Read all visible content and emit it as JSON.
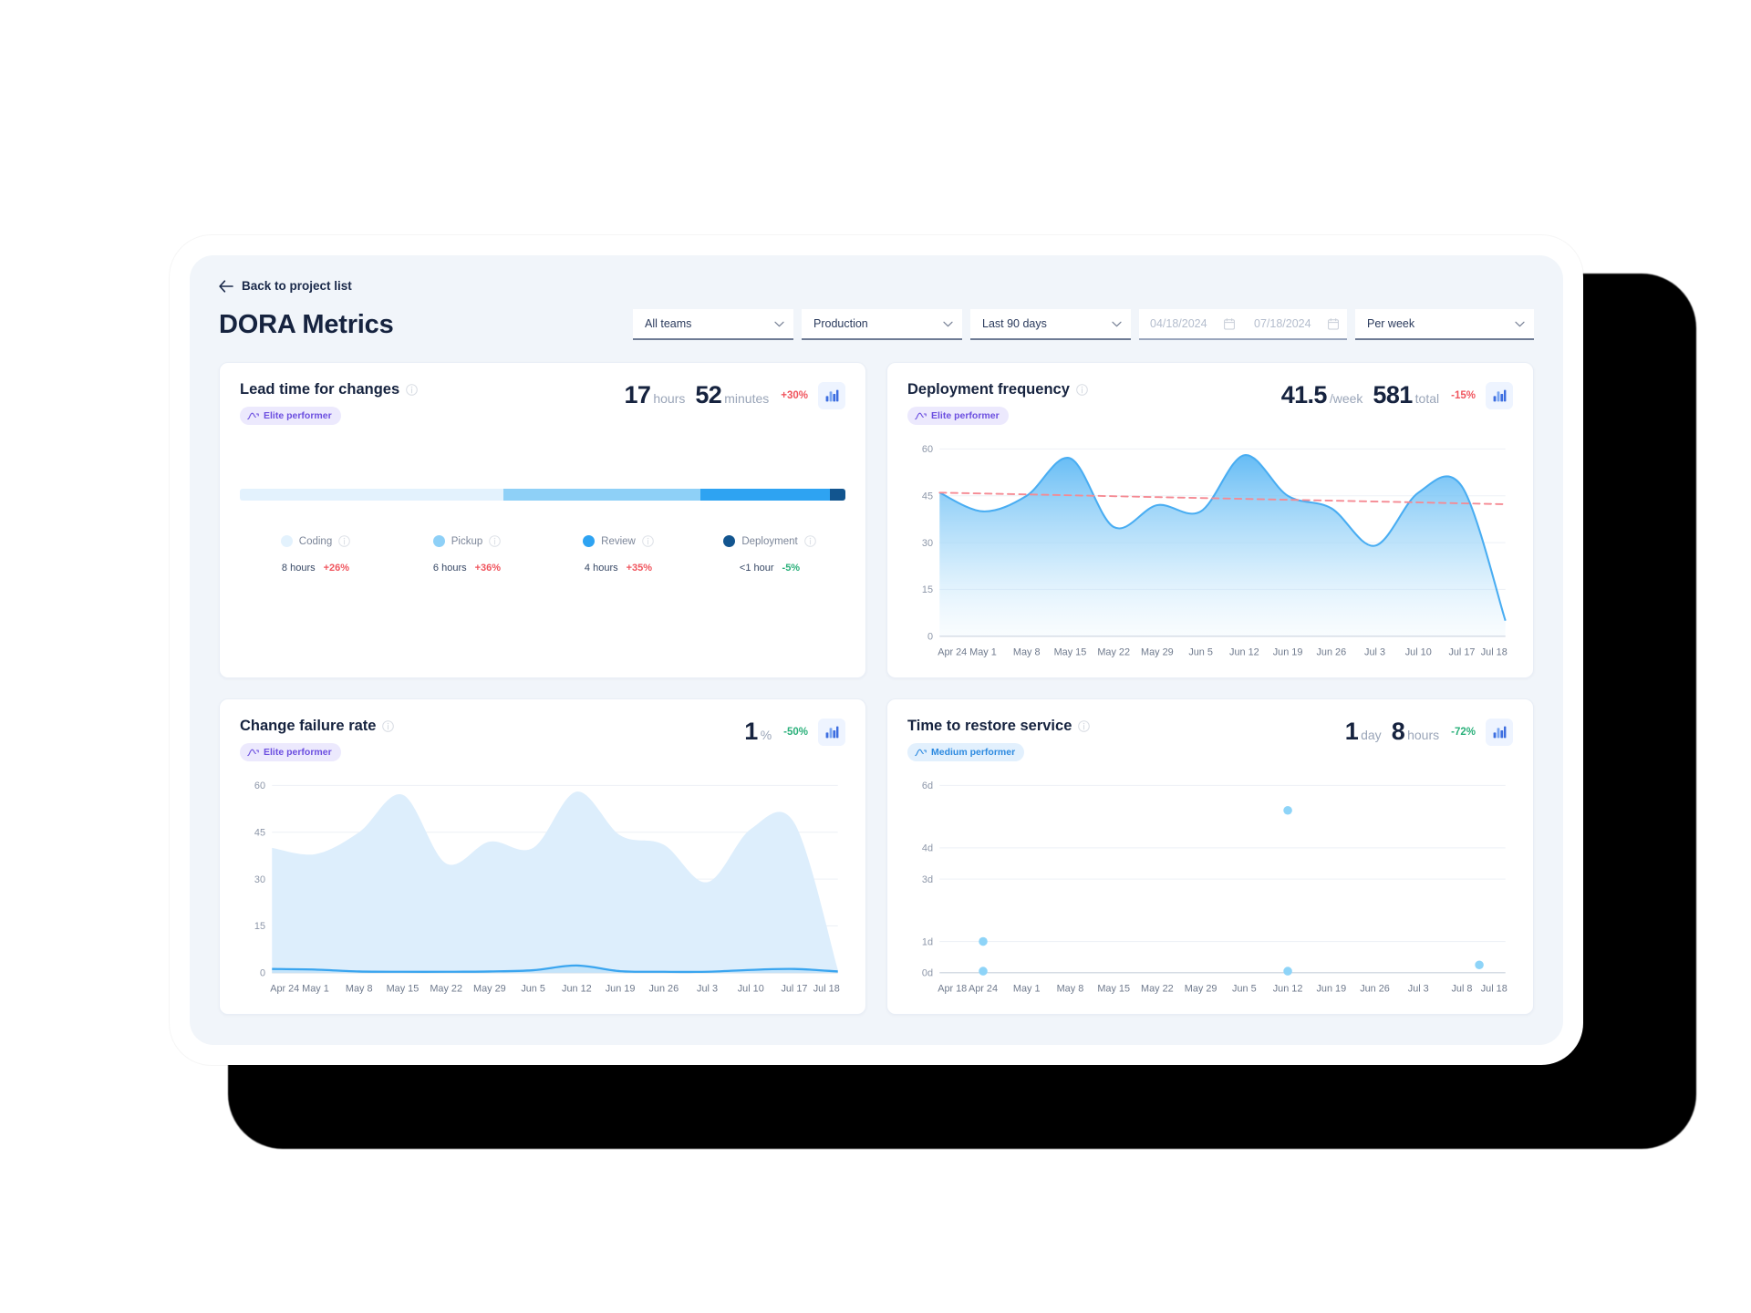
{
  "nav": {
    "back_label": "Back to project list",
    "back_icon": "arrow-left-icon"
  },
  "header": {
    "title": "DORA Metrics"
  },
  "filters": [
    {
      "name": "team",
      "value": "All teams",
      "icon": "chevron-down-icon"
    },
    {
      "name": "environment",
      "value": "Production",
      "icon": "chevron-down-icon"
    },
    {
      "name": "period",
      "value": "Last 90 days",
      "icon": "chevron-down-icon"
    },
    {
      "name": "granularity",
      "value": "Per week",
      "icon": "chevron-down-icon"
    }
  ],
  "date_range": {
    "start_placeholder": "04/18/2024",
    "end_placeholder": "07/18/2024",
    "icon": "calendar-icon"
  },
  "colors": {
    "accent": "#3aa5ef",
    "elite_badge_bg": "#ece9fd",
    "elite_badge_text": "#6c4fe0",
    "medium_badge_bg": "#e2f0fd",
    "medium_badge_text": "#2d8ae0",
    "trend_up": "#f0555e",
    "trend_down": "#2ab07a",
    "title": "#16233f",
    "page_bg": "#f1f5fa",
    "coding": "#e3f2fd",
    "pickup": "#8ed0f7",
    "review": "#2ea3f2",
    "deployment": "#12558f",
    "trendline": "#f58a93"
  },
  "cards": {
    "lead_time": {
      "title": "Lead time for changes",
      "info_icon": "info-icon",
      "badge": {
        "label": "Elite performer",
        "icon": "trend-spark-icon",
        "kind": "elite"
      },
      "stats": [
        {
          "value": "17",
          "unit": "hours"
        },
        {
          "value": "52",
          "unit": "minutes"
        }
      ],
      "trend": {
        "value": "+30%",
        "direction": "up"
      },
      "chart_button_icon": "bar-chart-icon",
      "segments": [
        {
          "label": "Coding",
          "value": "8 hours",
          "delta": "+26%",
          "delta_dir": "up",
          "pct": 43.5,
          "color": "#e3f2fd"
        },
        {
          "label": "Pickup",
          "value": "6 hours",
          "delta": "+36%",
          "delta_dir": "up",
          "pct": 32.5,
          "color": "#8ed0f7"
        },
        {
          "label": "Review",
          "value": "4 hours",
          "delta": "+35%",
          "delta_dir": "up",
          "pct": 21.5,
          "color": "#2ea3f2"
        },
        {
          "label": "Deployment",
          "value": "<1 hour",
          "delta": "-5%",
          "delta_dir": "down",
          "pct": 2.5,
          "color": "#12558f"
        }
      ]
    },
    "deployment_frequency": {
      "title": "Deployment frequency",
      "info_icon": "info-icon",
      "badge": {
        "label": "Elite performer",
        "icon": "trend-spark-icon",
        "kind": "elite"
      },
      "stats": [
        {
          "value": "41.5",
          "unit": "/week"
        },
        {
          "value": "581",
          "unit": "total"
        }
      ],
      "trend": {
        "value": "-15%",
        "direction": "up"
      },
      "chart_button_icon": "bar-chart-icon"
    },
    "change_failure_rate": {
      "title": "Change failure rate",
      "info_icon": "info-icon",
      "badge": {
        "label": "Elite performer",
        "icon": "trend-spark-icon",
        "kind": "elite"
      },
      "stats": [
        {
          "value": "1",
          "unit": "%"
        }
      ],
      "trend": {
        "value": "-50%",
        "direction": "down"
      },
      "chart_button_icon": "bar-chart-icon"
    },
    "time_to_restore": {
      "title": "Time to restore service",
      "info_icon": "info-icon",
      "badge": {
        "label": "Medium performer",
        "icon": "trend-spark-icon",
        "kind": "medium"
      },
      "stats": [
        {
          "value": "1",
          "unit": "day"
        },
        {
          "value": "8",
          "unit": "hours"
        }
      ],
      "trend": {
        "value": "-72%",
        "direction": "down"
      },
      "chart_button_icon": "bar-chart-icon"
    }
  },
  "chart_data": [
    {
      "id": "deployment-frequency-chart",
      "type": "area",
      "title": "Deployment frequency",
      "xlabel": "",
      "ylabel": "",
      "ylim": [
        0,
        60
      ],
      "yticks": [
        0,
        15,
        30,
        45,
        60
      ],
      "grid": true,
      "legend": "none",
      "x": [
        "Apr 24",
        "May 1",
        "May 8",
        "May 15",
        "May 22",
        "May 29",
        "Jun 5",
        "Jun 12",
        "Jun 19",
        "Jun 26",
        "Jul 3",
        "Jul 10",
        "Jul 17",
        "Jul 18"
      ],
      "series": [
        {
          "name": "Deployments per week",
          "values": [
            46,
            40,
            45,
            57,
            35,
            42,
            40,
            58,
            45,
            41,
            29,
            46,
            48,
            5
          ]
        },
        {
          "name": "Trend (average)",
          "style": "dashed",
          "color": "#f58a93",
          "values": [
            46,
            45.7,
            45.4,
            45.1,
            44.8,
            44.5,
            44.3,
            44.0,
            43.7,
            43.4,
            43.1,
            42.8,
            42.5,
            42.3
          ]
        }
      ]
    },
    {
      "id": "change-failure-rate-chart",
      "type": "area",
      "title": "Change failure rate",
      "xlabel": "",
      "ylabel": "",
      "ylim": [
        0,
        60
      ],
      "yticks": [
        0,
        15,
        30,
        45,
        60
      ],
      "grid": true,
      "legend": "none",
      "x": [
        "Apr 24",
        "May 1",
        "May 8",
        "May 15",
        "May 22",
        "May 29",
        "Jun 5",
        "Jun 12",
        "Jun 19",
        "Jun 26",
        "Jul 3",
        "Jul 10",
        "Jul 17",
        "Jul 18"
      ],
      "series": [
        {
          "name": "Deployments (background)",
          "color": "#ddeefc",
          "values": [
            40,
            38,
            45,
            57,
            35,
            42,
            40,
            58,
            44,
            41,
            29,
            46,
            48,
            1
          ]
        },
        {
          "name": "Failures",
          "color": "#3aa5ef",
          "values": [
            1.2,
            1.0,
            0.4,
            0.3,
            0.3,
            0.4,
            0.8,
            2.3,
            0.5,
            0.3,
            0.3,
            0.9,
            1.2,
            0.4
          ]
        }
      ]
    },
    {
      "id": "time-to-restore-chart",
      "type": "scatter",
      "title": "Time to restore service",
      "xlabel": "",
      "ylabel": "",
      "ylim": [
        0,
        6
      ],
      "yticks": [
        "0d",
        "1d",
        "3d",
        "4d",
        "6d"
      ],
      "ytick_values": [
        0,
        1,
        3,
        4,
        6
      ],
      "grid": true,
      "legend": "none",
      "x_ticks": [
        "Apr 18",
        "Apr 24",
        "May 1",
        "May 8",
        "May 15",
        "May 22",
        "May 29",
        "Jun 5",
        "Jun 12",
        "Jun 19",
        "Jun 26",
        "Jul 3",
        "Jul 8",
        "Jul 18"
      ],
      "points": [
        {
          "x": "Apr 24",
          "y": 1.0
        },
        {
          "x": "Apr 24",
          "y": 0.05
        },
        {
          "x": "Jun 12",
          "y": 5.2
        },
        {
          "x": "Jun 12",
          "y": 0.05
        },
        {
          "x": "Jul 11",
          "y": 0.25
        }
      ],
      "point_color": "#8ed4f8"
    }
  ]
}
